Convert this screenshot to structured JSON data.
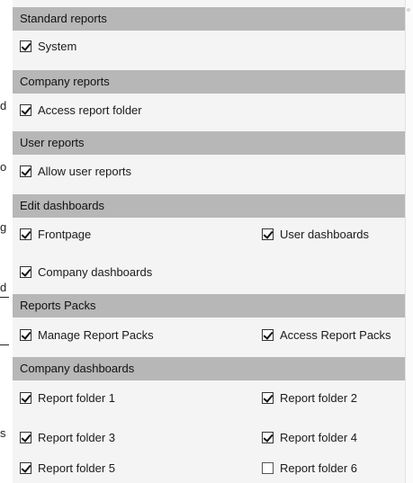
{
  "left_edge_fragments": [
    "d",
    "o",
    "g",
    "d",
    "s"
  ],
  "sections": [
    {
      "title": "Standard reports",
      "rows": [
        [
          {
            "label": "System",
            "checked": true
          }
        ]
      ]
    },
    {
      "title": "Company reports",
      "rows": [
        [
          {
            "label": "Access report folder",
            "checked": true
          }
        ]
      ]
    },
    {
      "title": "User reports",
      "rows": [
        [
          {
            "label": "Allow user reports",
            "checked": true
          }
        ]
      ]
    },
    {
      "title": "Edit dashboards",
      "rows": [
        [
          {
            "label": "Frontpage",
            "checked": true
          },
          {
            "label": "User dashboards",
            "checked": true
          }
        ],
        [
          {
            "label": "Company dashboards",
            "checked": true
          }
        ]
      ]
    },
    {
      "title": "Reports Packs",
      "rows": [
        [
          {
            "label": "Manage Report Packs",
            "checked": true
          },
          {
            "label": "Access Report Packs",
            "checked": true
          }
        ]
      ]
    },
    {
      "title": "Company dashboards",
      "rows": [
        [
          {
            "label": "Report folder 1",
            "checked": true
          },
          {
            "label": "Report folder 2",
            "checked": true
          }
        ],
        [
          {
            "label": "Report folder 3",
            "checked": true
          },
          {
            "label": "Report folder 4",
            "checked": true
          }
        ],
        [
          {
            "label": "Report folder 5",
            "checked": true
          },
          {
            "label": "Report folder 6",
            "checked": false
          }
        ]
      ]
    }
  ]
}
